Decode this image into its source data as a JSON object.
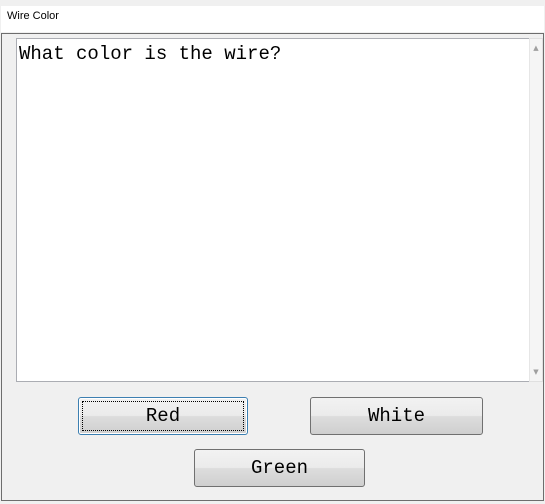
{
  "window": {
    "title": "Wire Color"
  },
  "prompt": {
    "text": "What color is the wire?"
  },
  "scrollbar": {
    "up_icon": "scroll-up-arrow",
    "down_icon": "scroll-down-arrow"
  },
  "buttons": {
    "red_label": "Red",
    "white_label": "White",
    "green_label": "Green"
  }
}
